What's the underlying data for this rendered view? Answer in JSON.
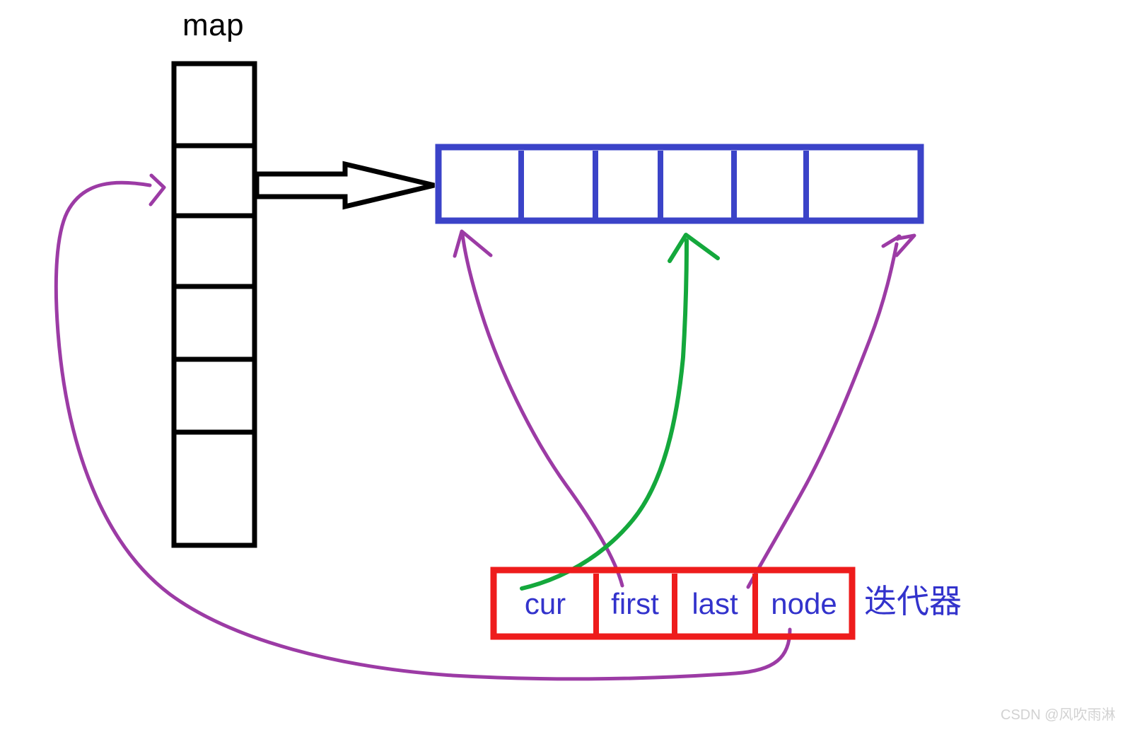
{
  "diagram": {
    "title_label": "map",
    "iterator_label": "迭代器",
    "watermark": "CSDN @风吹雨淋",
    "colors": {
      "map_stroke": "#000000",
      "buffer_stroke": "#3b43c8",
      "iterator_stroke": "#ee1c1c",
      "iterator_text": "#3333cc",
      "purple_arrow": "#9c3ba5",
      "green_arrow": "#14a83c",
      "black_arrow": "#000000",
      "watermark_text": "#d2d2d2"
    },
    "map_column": {
      "name": "map",
      "cell_count": 6,
      "cells": [
        "",
        "",
        "",
        "",
        "",
        ""
      ],
      "highlighted_cell_index": 1
    },
    "buffer_array": {
      "name": "buffer",
      "cell_count": 6,
      "cells": [
        "",
        "",
        "",
        "",
        "",
        ""
      ]
    },
    "iterator_box": {
      "name": "iterator",
      "fields": [
        {
          "label": "cur"
        },
        {
          "label": "first"
        },
        {
          "label": "last"
        },
        {
          "label": "node"
        }
      ]
    },
    "connections": [
      {
        "id": "map-to-buffer",
        "kind": "block-arrow",
        "color": "#000000",
        "from": "map.cell.1",
        "to": "buffer.cell.0"
      },
      {
        "id": "cur-to-buffer",
        "kind": "curve-arrow",
        "color": "#14a83c",
        "from": "iterator.cur",
        "to": "buffer.cell.3"
      },
      {
        "id": "first-to-buffer",
        "kind": "curve-arrow",
        "color": "#9c3ba5",
        "from": "iterator.first",
        "to": "buffer.cell.0"
      },
      {
        "id": "last-to-buffer",
        "kind": "curve-arrow",
        "color": "#9c3ba5",
        "from": "iterator.last",
        "to": "buffer.cell.5"
      },
      {
        "id": "node-to-map",
        "kind": "curve-arrow",
        "color": "#9c3ba5",
        "from": "iterator.node",
        "to": "map.cell.1"
      }
    ]
  }
}
